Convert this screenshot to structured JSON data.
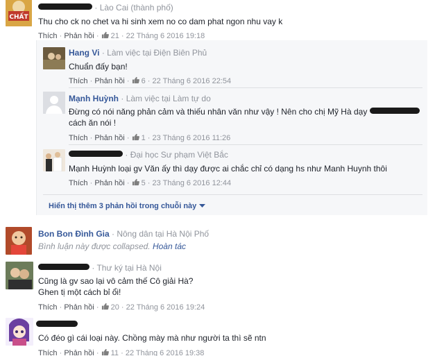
{
  "colors": {
    "link": "#365899",
    "meta": "#90949c",
    "panel": "#f6f7f9"
  },
  "actions": {
    "like": "Thích",
    "reply": "Phản hồi",
    "sep": "·"
  },
  "comments": [
    {
      "author": "",
      "meta": "Lào Cai (thành phố)",
      "text": "Thu cho ck no chet va hi sinh xem no co dam phat ngon nhu vay k",
      "likes": "21",
      "time": "22 Tháng 6 2016 19:18"
    }
  ],
  "replies": [
    {
      "author": "Hang Vi",
      "meta": "Làm việc tại Điện Biên Phủ",
      "text": "Chuẩn đấy bạn!",
      "likes": "6",
      "time": "22 Tháng 6 2016 22:54"
    },
    {
      "author": "Mạnh Huỳnh",
      "meta": "Làm việc tại Làm tự do",
      "text_line1": "Đừng có nói năng phản cảm và thiếu nhân văn như vậy ! Nên cho chị Mỹ Hà dạy",
      "text_line2": "cách ăn nói !",
      "likes": "1",
      "time": "23 Tháng 6 2016 11:26"
    },
    {
      "author": "",
      "meta": "Đại học Sư phạm Việt Bắc",
      "text": "Mạnh Huỳnh loại gv Văn ấy thì dạy được ai chắc chỉ có dạng hs như Manh Huynh thôi",
      "likes": "5",
      "time": "23 Tháng 6 2016 12:44"
    }
  ],
  "more_replies": "Hiển thị thêm 3 phản hồi trong chuỗi này",
  "collapsed_comment": {
    "author": "Bon Bon Đình Gia",
    "meta": "Nông dân tại Hà Nội Phố",
    "text": "Bình luận này được collapsed.",
    "undo": "Hoàn tác"
  },
  "comments2": [
    {
      "author": "",
      "meta": "Thư ký tại Hà Nội",
      "text_line1": "Cũng là gv sao lại vô cảm thế Cô giải Hà?",
      "text_line2": "Ghen tị một cách bỉ ổi!",
      "likes": "20",
      "time": "22 Tháng 6 2016 19:24"
    },
    {
      "author": "",
      "meta": "",
      "text": "Có đéo gì cái loại này. Chồng mày mà như người ta thì sẽ ntn",
      "likes": "11",
      "time": "22 Tháng 6 2016 19:38"
    }
  ]
}
